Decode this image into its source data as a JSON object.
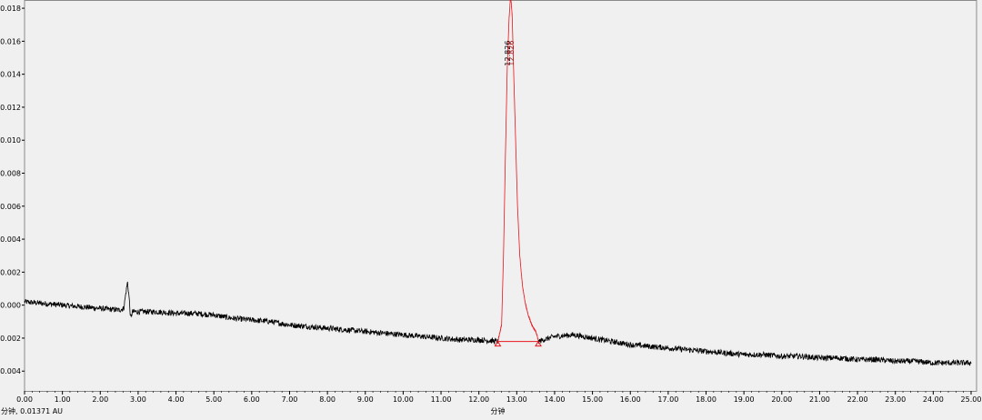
{
  "status_readout": "分钟, 0.01371 AU",
  "chart_data": {
    "type": "line",
    "xlabel": "分钟",
    "ylabel": "",
    "xlim": [
      0,
      25
    ],
    "ylim": [
      -0.0052,
      0.0185
    ],
    "x_ticks": [
      0,
      1,
      2,
      3,
      4,
      5,
      6,
      7,
      8,
      9,
      10,
      11,
      12,
      13,
      14,
      15,
      16,
      17,
      18,
      19,
      20,
      21,
      22,
      23,
      24,
      25
    ],
    "x_tick_labels": [
      "0.00",
      "1.00",
      "2.00",
      "3.00",
      "4.00",
      "5.00",
      "6.00",
      "7.00",
      "8.00",
      "9.00",
      "10.00",
      "11.00",
      "12.00",
      "13.00",
      "14.00",
      "15.00",
      "16.00",
      "17.00",
      "18.00",
      "19.00",
      "20.00",
      "21.00",
      "22.00",
      "23.00",
      "24.00",
      "25.00"
    ],
    "y_ticks": [
      -0.004,
      -0.002,
      0.0,
      0.002,
      0.004,
      0.006,
      0.008,
      0.01,
      0.012,
      0.014,
      0.016,
      0.018
    ],
    "y_tick_labels": [
      "-0.004",
      "-0.002",
      "0.000",
      "0.002",
      "0.004",
      "0.006",
      "0.008",
      "0.010",
      "0.012",
      "0.014",
      "0.016",
      "0.018"
    ],
    "grid": false,
    "colors": {
      "trace": "#000000",
      "peak": "#e8141b",
      "frame": "#8a8a8a",
      "background": "#f0f0f0"
    },
    "series": [
      {
        "color": "#000000",
        "points": [
          [
            0.0,
            0.0002
          ],
          [
            0.5,
            0.0001
          ],
          [
            1.0,
            0.0
          ],
          [
            1.5,
            -0.0001
          ],
          [
            2.0,
            -0.0002
          ],
          [
            2.5,
            -0.0003
          ],
          [
            2.62,
            -0.0002
          ],
          [
            2.68,
            0.0008
          ],
          [
            2.72,
            0.0014
          ],
          [
            2.76,
            0.0005
          ],
          [
            2.8,
            -0.0008
          ],
          [
            2.85,
            -0.0004
          ],
          [
            3.0,
            -0.0004
          ],
          [
            3.5,
            -0.0004
          ],
          [
            4.0,
            -0.0005
          ],
          [
            4.5,
            -0.0005
          ],
          [
            5.0,
            -0.0006
          ],
          [
            5.5,
            -0.0008
          ],
          [
            6.0,
            -0.0009
          ],
          [
            6.5,
            -0.001
          ],
          [
            7.0,
            -0.0012
          ],
          [
            7.5,
            -0.0013
          ],
          [
            8.0,
            -0.0014
          ],
          [
            8.5,
            -0.0015
          ],
          [
            9.0,
            -0.0016
          ],
          [
            9.5,
            -0.0017
          ],
          [
            10.0,
            -0.0018
          ],
          [
            10.5,
            -0.0019
          ],
          [
            11.0,
            -0.002
          ],
          [
            11.5,
            -0.0021
          ],
          [
            12.0,
            -0.0021
          ],
          [
            12.5,
            -0.0022
          ],
          [
            13.0,
            -0.0022
          ],
          [
            13.57,
            -0.0022
          ],
          [
            14.0,
            -0.0019
          ],
          [
            14.5,
            -0.0018
          ],
          [
            15.0,
            -0.002
          ],
          [
            15.5,
            -0.0022
          ],
          [
            16.0,
            -0.0024
          ],
          [
            16.5,
            -0.0025
          ],
          [
            17.0,
            -0.0026
          ],
          [
            17.5,
            -0.0027
          ],
          [
            18.0,
            -0.0028
          ],
          [
            18.5,
            -0.0029
          ],
          [
            19.0,
            -0.003
          ],
          [
            19.5,
            -0.003
          ],
          [
            20.0,
            -0.0031
          ],
          [
            20.5,
            -0.0031
          ],
          [
            21.0,
            -0.0032
          ],
          [
            21.5,
            -0.0032
          ],
          [
            22.0,
            -0.0033
          ],
          [
            22.5,
            -0.0033
          ],
          [
            23.0,
            -0.0034
          ],
          [
            23.5,
            -0.0034
          ],
          [
            24.0,
            -0.0035
          ],
          [
            24.5,
            -0.0035
          ],
          [
            25.0,
            -0.0035
          ]
        ]
      },
      {
        "color": "#e8141b",
        "points": [
          [
            12.5,
            -0.0022
          ],
          [
            12.6,
            -0.0012
          ],
          [
            12.65,
            0.003
          ],
          [
            12.7,
            0.009
          ],
          [
            12.75,
            0.0145
          ],
          [
            12.8,
            0.0175
          ],
          [
            12.84,
            0.0188
          ],
          [
            12.88,
            0.0175
          ],
          [
            12.92,
            0.014
          ],
          [
            12.97,
            0.01
          ],
          [
            13.02,
            0.006
          ],
          [
            13.08,
            0.003
          ],
          [
            13.15,
            0.0012
          ],
          [
            13.22,
            0.0002
          ],
          [
            13.3,
            -0.0006
          ],
          [
            13.4,
            -0.0012
          ],
          [
            13.5,
            -0.0016
          ],
          [
            13.57,
            -0.0021
          ]
        ]
      }
    ],
    "baseline": {
      "color": "#e8141b",
      "x": [
        12.5,
        13.57
      ],
      "y": [
        -0.0022,
        -0.0022
      ]
    },
    "annotations": [
      {
        "x": 12.83,
        "y": 0.0145,
        "text": "12.826"
      },
      {
        "x": 12.92,
        "y": 0.0145,
        "text": "12.826"
      }
    ]
  }
}
